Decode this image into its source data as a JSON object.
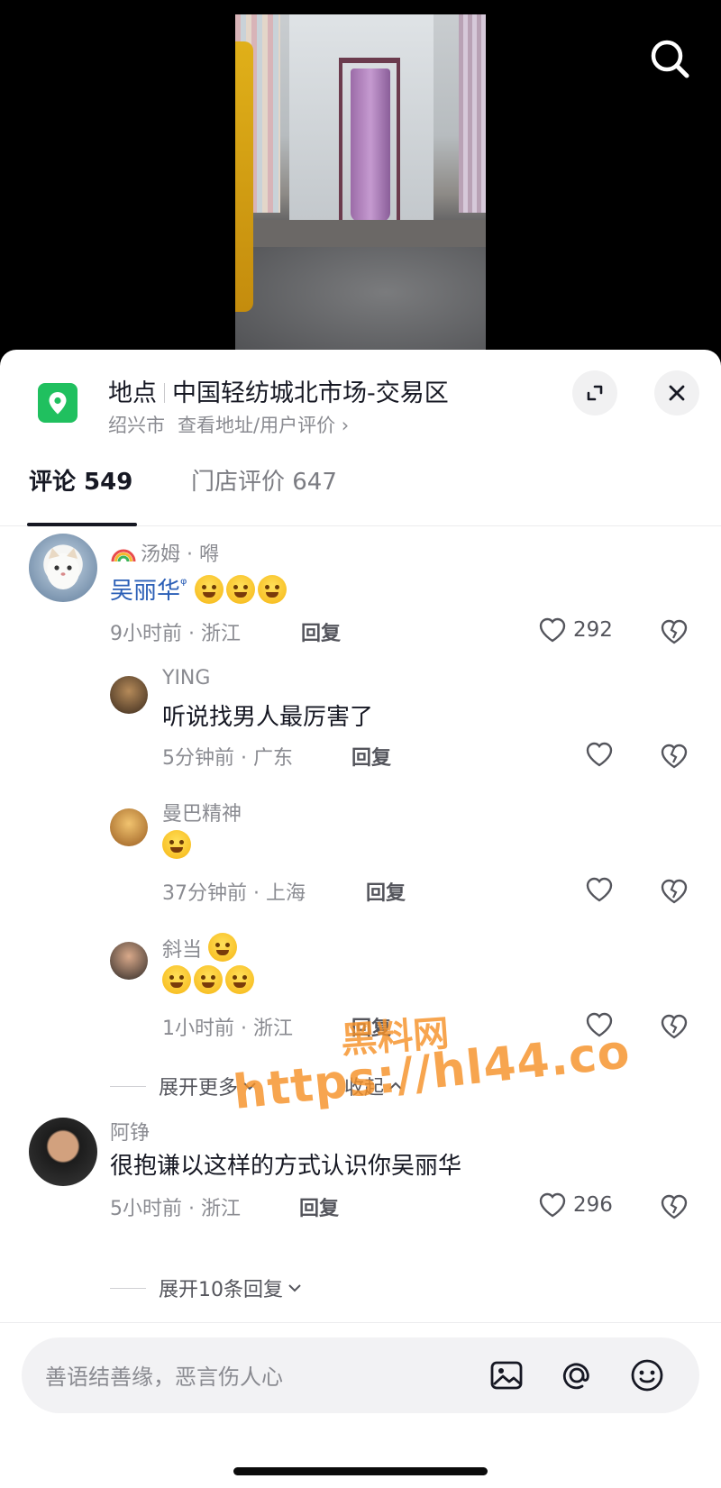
{
  "location": {
    "label": "地点",
    "name": "中国轻纺城北市场-交易区",
    "city": "绍兴市",
    "link": "查看地址/用户评价",
    "chevron": "›"
  },
  "tabs": [
    {
      "label": "评论 549",
      "active": true
    },
    {
      "label": "门店评价 647",
      "active": false
    }
  ],
  "comments": {
    "c1": {
      "name": "汤姆 · 嘚",
      "text": "吴丽华",
      "text_suffix": "ᵠ",
      "meta": "9小时前 · 浙江",
      "reply": "回复",
      "likes": "292"
    },
    "r1": {
      "name": "YING",
      "text": "听说找男人最厉害了",
      "meta": "5分钟前 · 广东",
      "reply": "回复"
    },
    "r2": {
      "name": "曼巴精神",
      "meta": "37分钟前 · 上海",
      "reply": "回复"
    },
    "r3": {
      "name": "斜当",
      "meta": "1小时前 · 浙江",
      "reply": "回复"
    },
    "expand1": {
      "more": "展开更多",
      "collapse": "收起"
    },
    "c2": {
      "name": "阿铮",
      "text": "很抱谦以这样的方式认识你吴丽华",
      "meta": "5小时前 · 浙江",
      "reply": "回复",
      "likes": "296"
    },
    "expand2": {
      "label": "展开10条回复"
    }
  },
  "input": {
    "placeholder": "善语结善缘，恶言伤人心"
  },
  "watermark": {
    "line1": "黑料网",
    "line2": "https://hl44.co"
  },
  "colors": {
    "accent": "#20c05f",
    "watermark": "#f59128",
    "text": "#161823",
    "muted": "#8a8b91"
  },
  "icons": [
    "search-icon",
    "location-pin-icon",
    "expand-icon",
    "close-icon",
    "heart-icon",
    "broken-heart-icon",
    "image-icon",
    "at-icon",
    "emoji-icon"
  ]
}
